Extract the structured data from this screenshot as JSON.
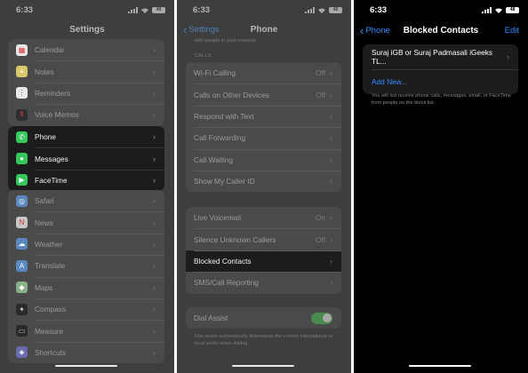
{
  "status": {
    "time": "6:33",
    "battery": "48"
  },
  "settings": {
    "title": "Settings",
    "top_items": [
      {
        "label": "Calendar",
        "icon": "calendar-icon",
        "color": "#e8e8e8"
      },
      {
        "label": "Notes",
        "icon": "notes-icon",
        "color": "#d9c86a"
      },
      {
        "label": "Reminders",
        "icon": "reminders-icon",
        "color": "#e8e8e8"
      },
      {
        "label": "Voice Memos",
        "icon": "voice-memos-icon",
        "color": "#3a3a3a"
      }
    ],
    "highlight_items": [
      {
        "label": "Phone",
        "icon": "phone-icon",
        "color": "#34c759"
      },
      {
        "label": "Messages",
        "icon": "messages-icon",
        "color": "#34c759"
      },
      {
        "label": "FaceTime",
        "icon": "facetime-icon",
        "color": "#34c759"
      }
    ],
    "bottom_items": [
      {
        "label": "Safari",
        "icon": "safari-icon",
        "color": "#5a88c0"
      },
      {
        "label": "News",
        "icon": "news-icon",
        "color": "#c8c8c8"
      },
      {
        "label": "Weather",
        "icon": "weather-icon",
        "color": "#5a88c0"
      },
      {
        "label": "Translate",
        "icon": "translate-icon",
        "color": "#5a88c0"
      },
      {
        "label": "Maps",
        "icon": "maps-icon",
        "color": "#8ab08a"
      },
      {
        "label": "Compass",
        "icon": "compass-icon",
        "color": "#2a2a2a"
      },
      {
        "label": "Measure",
        "icon": "measure-icon",
        "color": "#2a2a2a"
      },
      {
        "label": "Shortcuts",
        "icon": "shortcuts-icon",
        "color": "#6a6ab0"
      }
    ]
  },
  "phone": {
    "back": "Settings",
    "title": "Phone",
    "top_text": "with people in your contacts.",
    "calls_header": "CALLS",
    "calls_items": [
      {
        "label": "Wi-Fi Calling",
        "value": "Off"
      },
      {
        "label": "Calls on Other Devices",
        "value": "Off"
      },
      {
        "label": "Respond with Text",
        "value": ""
      },
      {
        "label": "Call Forwarding",
        "value": ""
      },
      {
        "label": "Call Waiting",
        "value": ""
      },
      {
        "label": "Show My Caller ID",
        "value": ""
      }
    ],
    "second_items": [
      {
        "label": "Live Voicemail",
        "value": "On"
      },
      {
        "label": "Silence Unknown Callers",
        "value": "Off"
      },
      {
        "label": "Blocked Contacts",
        "value": ""
      },
      {
        "label": "SMS/Call Reporting",
        "value": ""
      }
    ],
    "dial_assist": {
      "label": "Dial Assist",
      "on": true,
      "footnote": "Dial assist automatically determines the correct international or local prefix when dialing."
    }
  },
  "blocked": {
    "back": "Phone",
    "title": "Blocked Contacts",
    "edit": "Edit",
    "contact": "Suraj iGB or Suraj Padmasali iGeeks TL...",
    "add_new": "Add New...",
    "note": "You will not receive phone calls, messages, email, or FaceTime from people on the block list."
  }
}
